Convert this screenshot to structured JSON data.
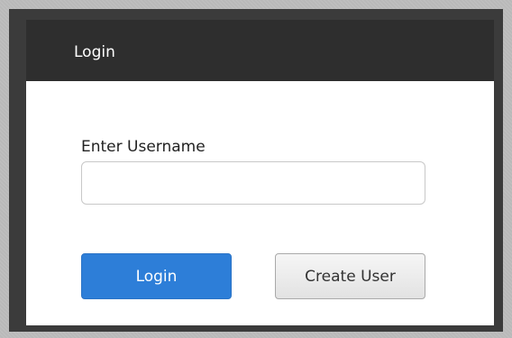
{
  "dialog": {
    "title": "Login",
    "username_label": "Enter Username",
    "username_value": "",
    "username_placeholder": "",
    "login_button_label": "Login",
    "create_user_button_label": "Create User"
  },
  "colors": {
    "title_bar": "#2e2e2e",
    "login_button": "#2d7ed8",
    "create_button": "#e9e9e9"
  }
}
